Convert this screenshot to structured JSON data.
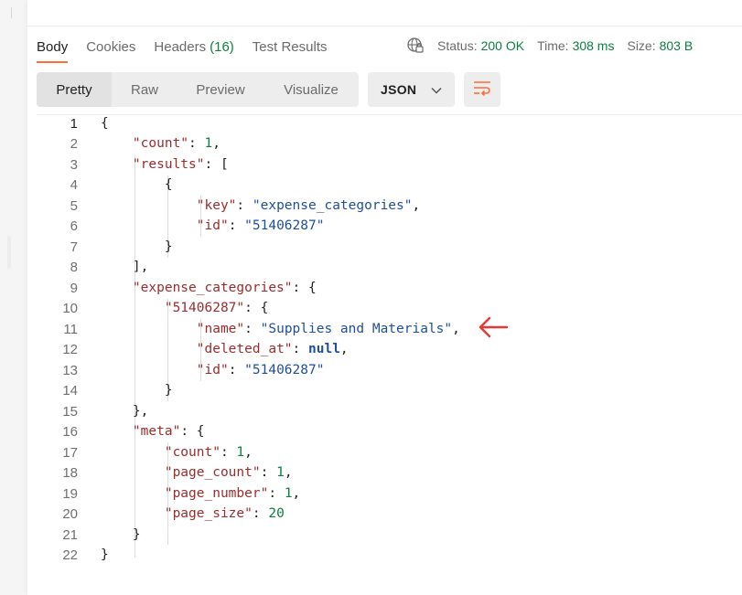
{
  "tabs": [
    {
      "label": "Body",
      "count": ""
    },
    {
      "label": "Cookies",
      "count": ""
    },
    {
      "label": "Headers",
      "count": "(16)"
    },
    {
      "label": "Test Results",
      "count": ""
    }
  ],
  "status": {
    "status_label": "Status:",
    "status_value": "200 OK",
    "time_label": "Time:",
    "time_value": "308 ms",
    "size_label": "Size:",
    "size_value": "803 B"
  },
  "view_modes": [
    "Pretty",
    "Raw",
    "Preview",
    "Visualize"
  ],
  "format": "JSON",
  "line_numbers": [
    "1",
    "2",
    "3",
    "4",
    "5",
    "6",
    "7",
    "8",
    "9",
    "10",
    "11",
    "12",
    "13",
    "14",
    "15",
    "16",
    "17",
    "18",
    "19",
    "20",
    "21",
    "22"
  ],
  "json": {
    "count_key": "\"count\"",
    "count_val": "1",
    "results_key": "\"results\"",
    "key_key": "\"key\"",
    "key_val": "\"expense_categories\"",
    "id_key": "\"id\"",
    "id_val": "\"51406287\"",
    "ec_key": "\"expense_categories\"",
    "id_obj_key": "\"51406287\"",
    "name_key": "\"name\"",
    "name_val": "\"Supplies and Materials\"",
    "deleted_key": "\"deleted_at\"",
    "deleted_val": "null",
    "id2_key": "\"id\"",
    "id2_val": "\"51406287\"",
    "meta_key": "\"meta\"",
    "mcount_key": "\"count\"",
    "mcount_val": "1",
    "pcount_key": "\"page_count\"",
    "pcount_val": "1",
    "pnum_key": "\"page_number\"",
    "pnum_val": "1",
    "psize_key": "\"page_size\"",
    "psize_val": "20"
  },
  "colors": {
    "accent": "#ff6c37",
    "success": "#0a7f3f",
    "key": "#9b2c2c",
    "string": "#1f4e9c",
    "annotation": "#e53935"
  }
}
